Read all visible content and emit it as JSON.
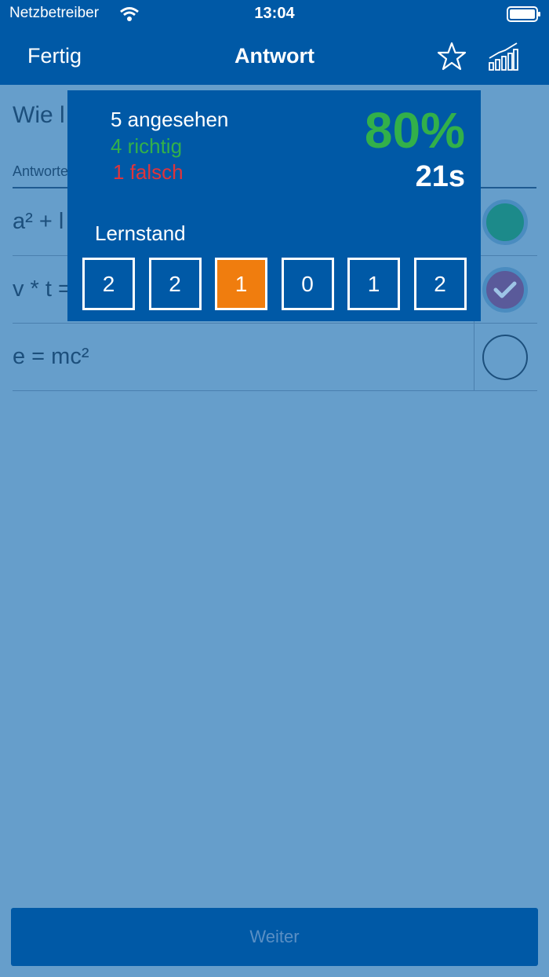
{
  "status_bar": {
    "carrier": "Netzbetreiber",
    "time": "13:04"
  },
  "nav": {
    "done_label": "Fertig",
    "title": "Antwort",
    "star_icon": "star-icon",
    "stats_icon": "bar-chart-icon"
  },
  "question": {
    "text": "Wie l",
    "answers_label": "Antworte"
  },
  "answers": [
    {
      "text": "a² + l",
      "state": "filled"
    },
    {
      "text": "v * t =",
      "state": "checked"
    },
    {
      "text": "e = mc²",
      "state": "empty"
    }
  ],
  "stats": {
    "viewed": "5 angesehen",
    "correct": "4 richtig",
    "wrong": "1 falsch",
    "percent": "80%",
    "time": "21s",
    "level_label": "Lernstand",
    "levels": [
      "2",
      "2",
      "1",
      "0",
      "1",
      "2"
    ],
    "active_level_index": 2
  },
  "next_button": {
    "label": "Weiter"
  },
  "colors": {
    "primary": "#0059a6",
    "background": "#669ecb",
    "correct": "#32b04a",
    "wrong": "#e0343b",
    "active_level": "#f07d0e"
  }
}
